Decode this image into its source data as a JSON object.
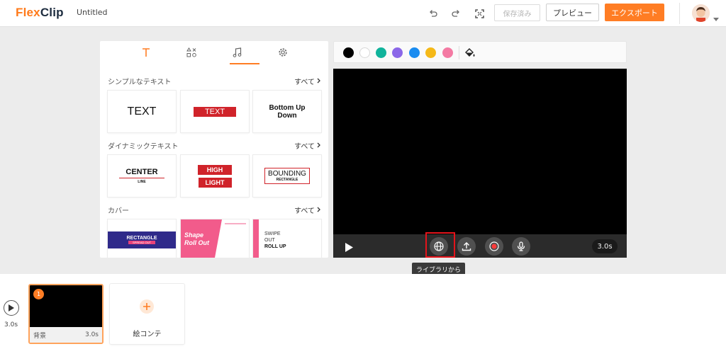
{
  "header": {
    "logo_part1": "Flex",
    "logo_part2": "Clip",
    "doc_title": "Untitled",
    "saved_label": "保存済み",
    "preview_label": "プレビュー",
    "export_label": "エクスポート"
  },
  "left_panel": {
    "sections": [
      {
        "title": "シンプルなテキスト",
        "see_all": "すべて"
      },
      {
        "title": "ダイナミックテキスト",
        "see_all": "すべて"
      },
      {
        "title": "カバー",
        "see_all": "すべて"
      }
    ],
    "simple_cards": [
      "TEXT",
      "TEXT",
      "Bottom Up",
      "Down"
    ],
    "dynamic_cards": [
      "CENTER",
      "LINE",
      "HIGH",
      "LIGHT",
      "BOUNDING",
      "RECTANGLE"
    ],
    "cover_cards": [
      "RECTANGLE",
      "SPREAD OUT",
      "Shape",
      "Roll Out",
      "SWIPE",
      "OUT",
      "ROLL UP"
    ]
  },
  "colors": [
    "#000000",
    "#ffffff",
    "#10b39b",
    "#8b67e8",
    "#1a8cf0",
    "#f5b918",
    "#f47aa3"
  ],
  "player": {
    "duration": "3.0s",
    "tooltip": "ライブラリから"
  },
  "timeline": {
    "total": "3.0s",
    "scene_number": "1",
    "scene_label": "背景",
    "scene_duration": "3.0s",
    "add_label": "絵コンテ"
  }
}
